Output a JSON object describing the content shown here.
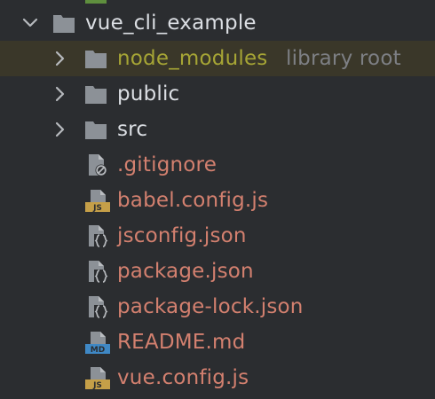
{
  "project": {
    "name": "vue_cli_example",
    "expanded": true,
    "icon": "folder-icon",
    "children": [
      {
        "name": "node_modules",
        "type": "folder",
        "hint": "library root",
        "expanded": false,
        "icon": "folder-icon",
        "color": "#a6a535"
      },
      {
        "name": "public",
        "type": "folder",
        "expanded": false,
        "icon": "folder-icon",
        "color": "#dcdfe4"
      },
      {
        "name": "src",
        "type": "folder",
        "expanded": false,
        "icon": "folder-icon",
        "color": "#dcdfe4"
      },
      {
        "name": ".gitignore",
        "type": "file",
        "icon": "ignore-file-icon",
        "color": "#d3806f"
      },
      {
        "name": "babel.config.js",
        "type": "file",
        "icon": "js-file-icon",
        "badge": "JS",
        "color": "#d3806f"
      },
      {
        "name": "jsconfig.json",
        "type": "file",
        "icon": "json-file-icon",
        "color": "#d3806f"
      },
      {
        "name": "package.json",
        "type": "file",
        "icon": "json-file-icon",
        "color": "#d3806f"
      },
      {
        "name": "package-lock.json",
        "type": "file",
        "icon": "json-file-icon",
        "color": "#d3806f"
      },
      {
        "name": "README.md",
        "type": "file",
        "icon": "markdown-file-icon",
        "badge": "MD",
        "color": "#d3806f"
      },
      {
        "name": "vue.config.js",
        "type": "file",
        "icon": "js-file-icon",
        "badge": "JS",
        "color": "#d3806f"
      }
    ]
  },
  "colors": {
    "background": "#2b2d30",
    "selected_row": "#3a3729",
    "folder_icon": "#8c9197",
    "js_badge": "#c59f48",
    "md_badge": "#3f88c5",
    "hint": "#7d7f84"
  }
}
